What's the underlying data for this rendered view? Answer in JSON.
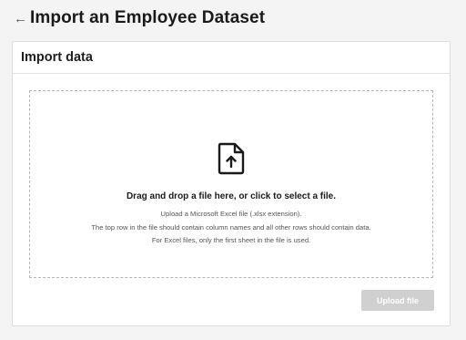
{
  "header": {
    "back_icon": "left-arrow-icon",
    "title": "Import an Employee Dataset"
  },
  "card": {
    "title": "Import data",
    "dropzone": {
      "icon": "file-upload-icon",
      "main_text": "Drag and drop a file here, or click to select a file.",
      "help_lines": [
        "Upload a Microsoft Excel file (.xlsx extension).",
        "The top row in the file should contain column names and all other rows should contain data.",
        "For Excel files, only the first sheet in the file is used."
      ]
    },
    "upload_button": {
      "label": "Upload file",
      "disabled": true
    }
  },
  "colors": {
    "page_background": "#f4f4f4",
    "card_background": "#ffffff",
    "button_disabled": "#d0d0d0"
  }
}
